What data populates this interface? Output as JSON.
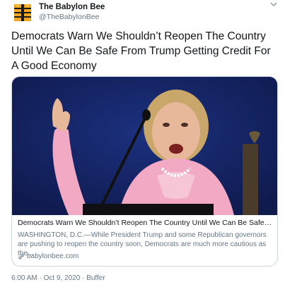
{
  "account": {
    "name": "The Babylon Bee",
    "handle": "@TheBabylonBee"
  },
  "tweet": {
    "text": "Democrats Warn We Shouldn’t Reopen The Country Until We Can Be Safe From Trump Getting Credit For A Good Economy"
  },
  "card": {
    "title": "Democrats Warn We Shouldn’t Reopen The Country Until We Can Be Safe From ...",
    "description": "WASHINGTON, D.C.—While President Trump and some Republican governors are pushing to reopen the country soon, Democrats are much more cautious as the...",
    "link": "babylonbee.com"
  },
  "meta": {
    "time": "6:00 AM",
    "separator": " · ",
    "date": "Oct 9, 2020",
    "source": "Buffer"
  },
  "icons": {
    "avatar": "babylon-bee-logo",
    "menu": "chevron-down-icon",
    "link": "link-icon"
  },
  "colors": {
    "name": "#14171a",
    "secondary": "#657786",
    "border": "#ccd6dd",
    "logo": "#f5a623"
  }
}
